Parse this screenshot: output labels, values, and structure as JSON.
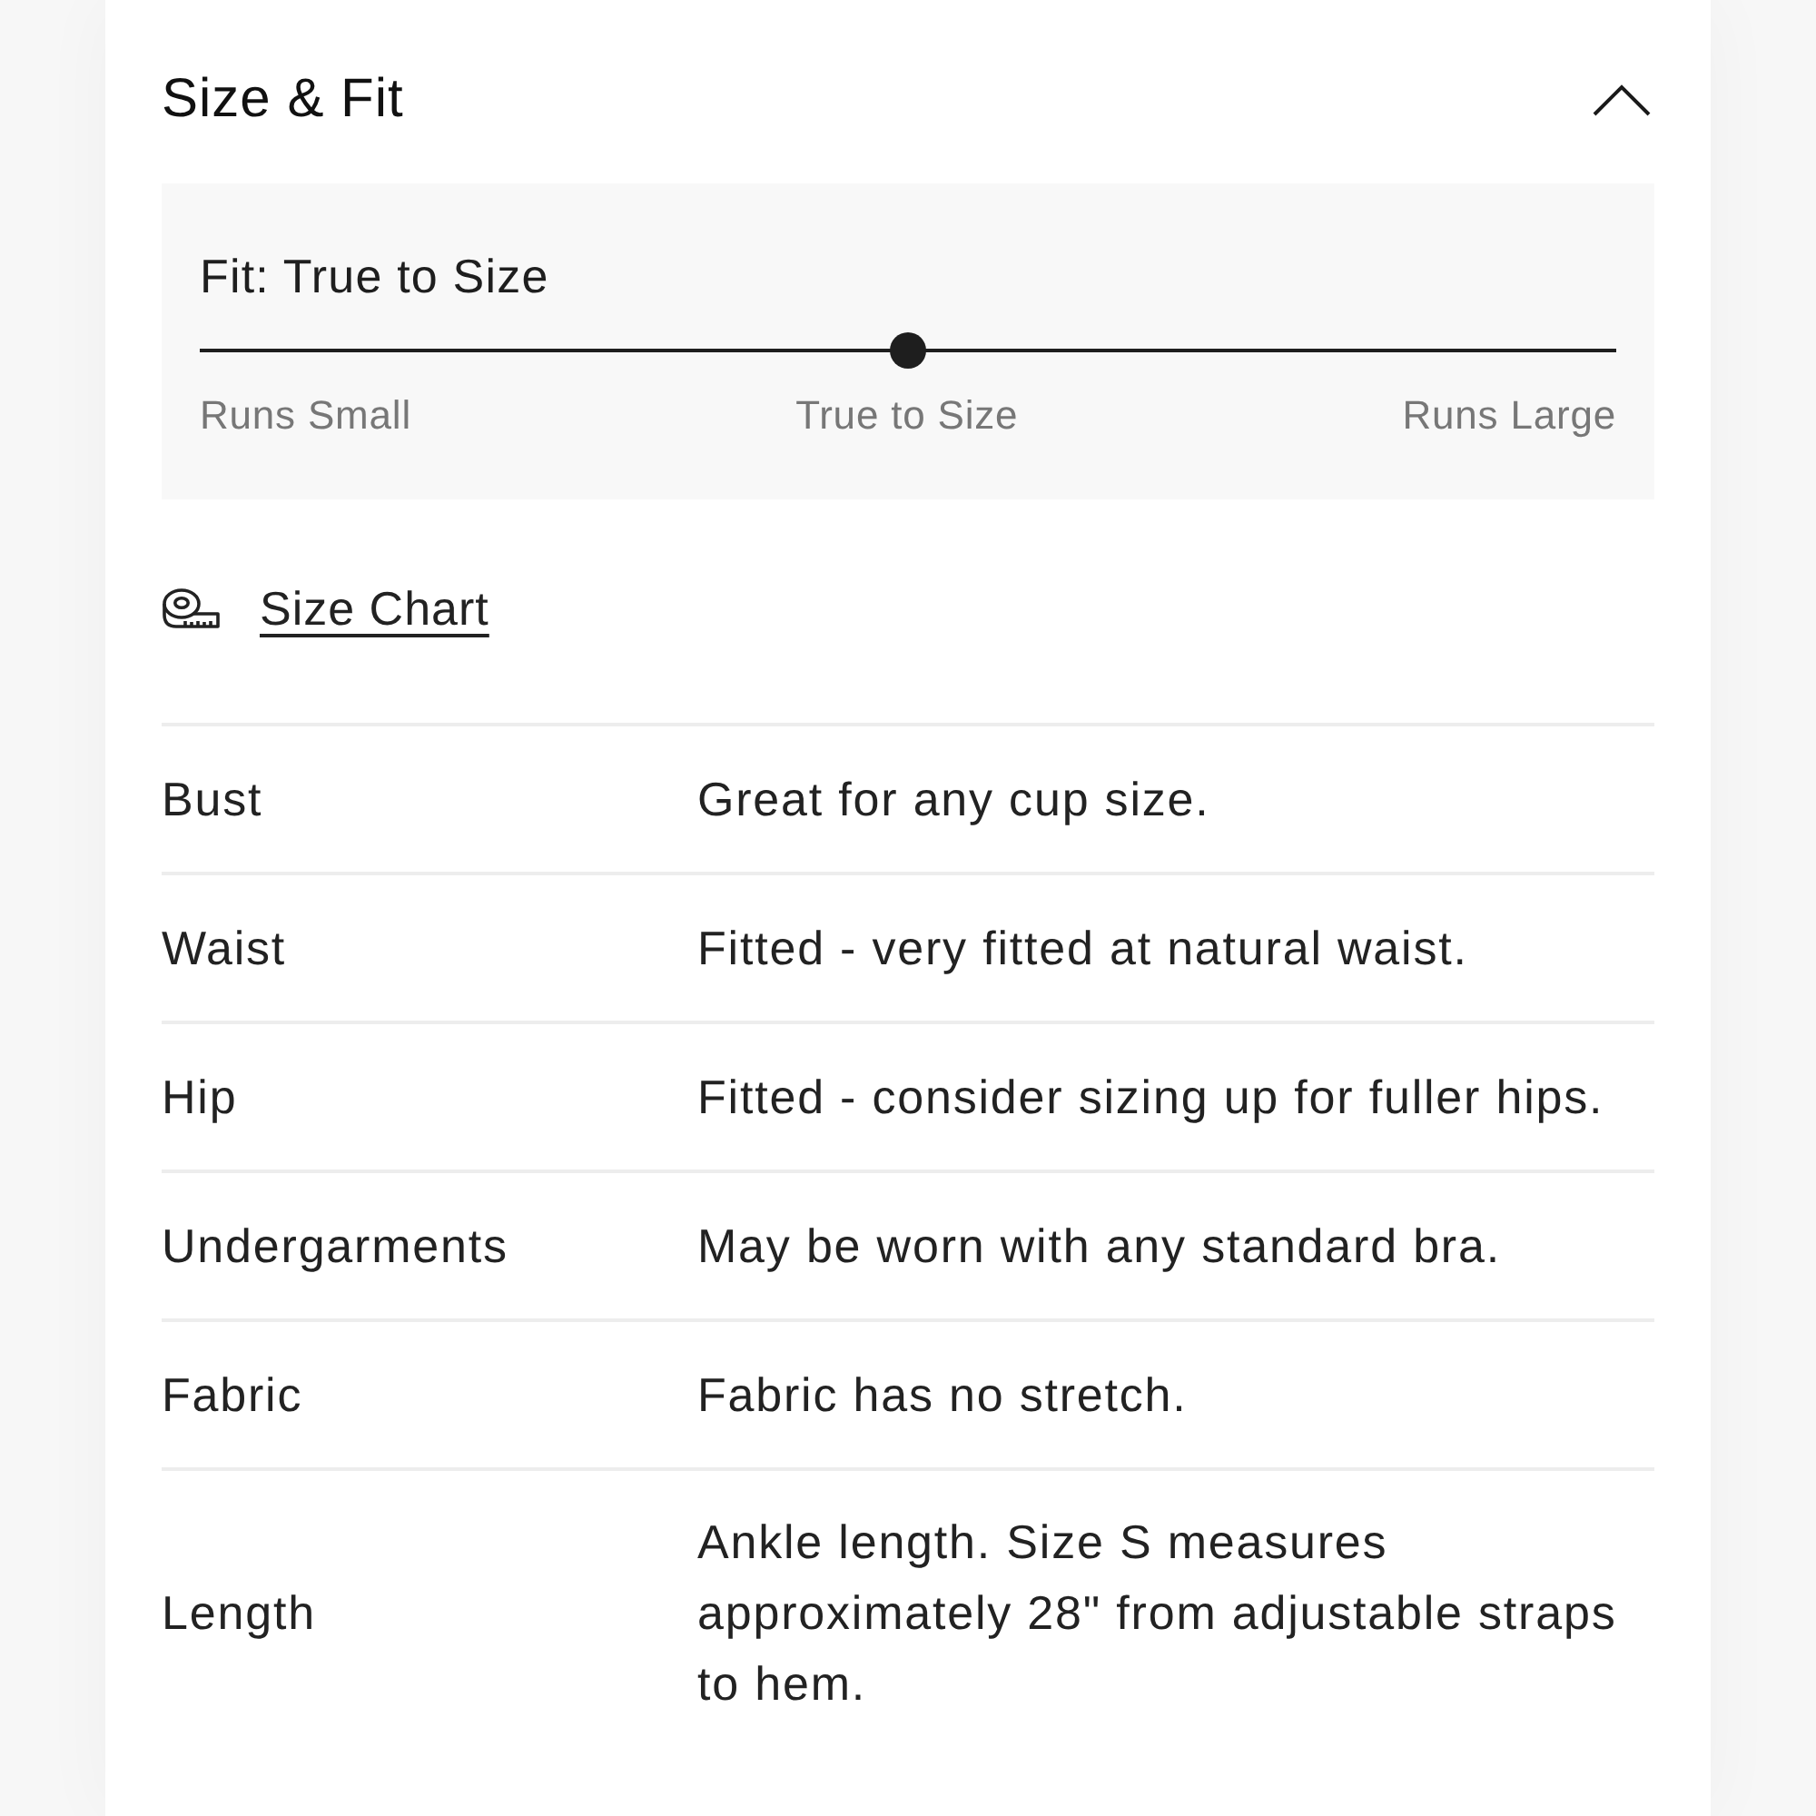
{
  "section": {
    "title": "Size & Fit",
    "expanded": true
  },
  "fit": {
    "heading": "Fit: True to Size",
    "level": 0.5,
    "labels": [
      "Runs Small",
      "True to Size",
      "Runs Large"
    ]
  },
  "size_chart_link": "Size Chart",
  "details": [
    {
      "label": "Bust",
      "value": "Great for any cup size."
    },
    {
      "label": "Waist",
      "value": "Fitted - very fitted at natural waist."
    },
    {
      "label": "Hip",
      "value": "Fitted - consider sizing up for fuller hips."
    },
    {
      "label": "Undergarments",
      "value": "May be worn with any standard bra."
    },
    {
      "label": "Fabric",
      "value": "Fabric has no stretch."
    },
    {
      "label": "Length",
      "value": "Ankle length. Size S measures approximately 28\" from adjustable straps to hem."
    }
  ]
}
